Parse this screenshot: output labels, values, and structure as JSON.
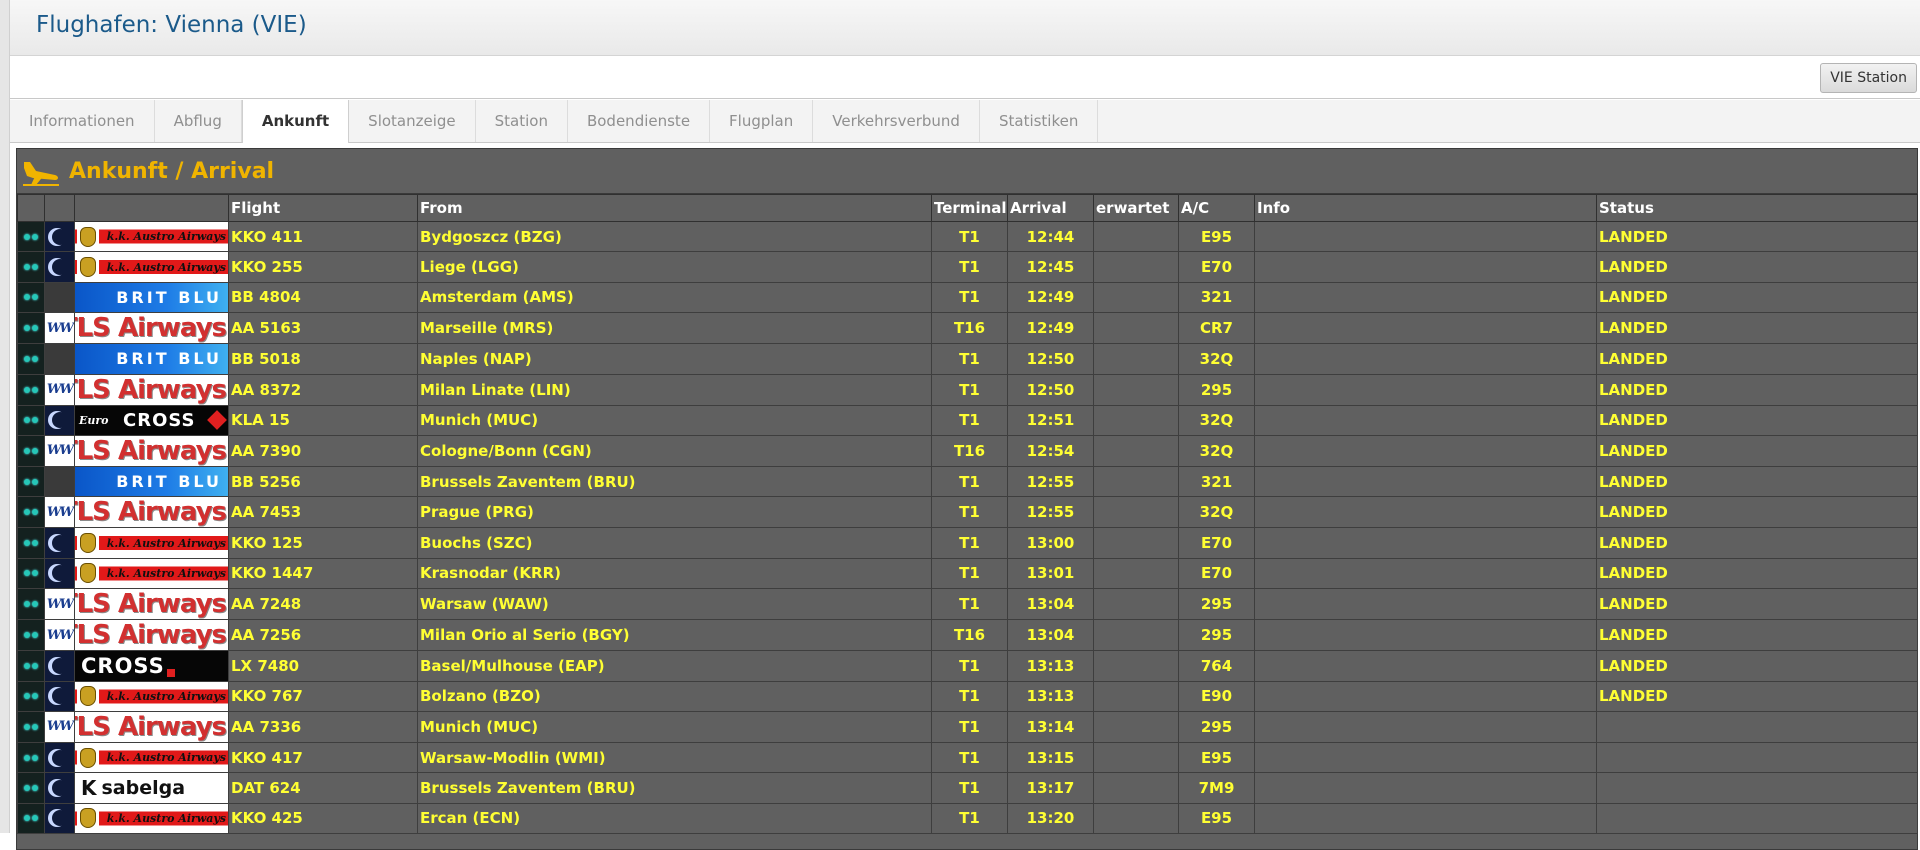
{
  "header": {
    "title": "Flughafen: Vienna (VIE)",
    "station_button": "VIE Station"
  },
  "tabs": [
    {
      "label": "Informationen",
      "active": false
    },
    {
      "label": "Abflug",
      "active": false
    },
    {
      "label": "Ankunft",
      "active": true
    },
    {
      "label": "Slotanzeige",
      "active": false
    },
    {
      "label": "Station",
      "active": false
    },
    {
      "label": "Bodendienste",
      "active": false
    },
    {
      "label": "Flugplan",
      "active": false
    },
    {
      "label": "Verkehrsverbund",
      "active": false
    },
    {
      "label": "Statistiken",
      "active": false
    }
  ],
  "board": {
    "title": "Ankunft / Arrival",
    "accent_color": "#f0b400",
    "value_color": "#ffff33",
    "columns": {
      "flight": "Flight",
      "from": "From",
      "terminal": "Terminal",
      "arrival": "Arrival",
      "expected": "erwartet",
      "ac": "A/C",
      "info": "Info",
      "status": "Status"
    },
    "logos": {
      "kk": {
        "text": "k.k. Austro Airways"
      },
      "brit": {
        "text": "BRIT BLU"
      },
      "tls": {
        "text": "TLS Airways",
        "badge": "WW"
      },
      "euro": {
        "text": "CROSS",
        "prefix": "Euro"
      },
      "cross": {
        "text": "CROSS"
      },
      "sabelga": {
        "text": "sabelga",
        "mark": "K"
      }
    },
    "rows": [
      {
        "logo": "kk",
        "flight": "KKO 411",
        "from": "Bydgoszcz (BZG)",
        "terminal": "T1",
        "arrival": "12:44",
        "expected": "",
        "ac": "E95",
        "info": "",
        "status": "LANDED"
      },
      {
        "logo": "kk",
        "flight": "KKO 255",
        "from": "Liege (LGG)",
        "terminal": "T1",
        "arrival": "12:45",
        "expected": "",
        "ac": "E70",
        "info": "",
        "status": "LANDED"
      },
      {
        "logo": "brit",
        "flight": "BB 4804",
        "from": "Amsterdam (AMS)",
        "terminal": "T1",
        "arrival": "12:49",
        "expected": "",
        "ac": "321",
        "info": "",
        "status": "LANDED"
      },
      {
        "logo": "tls",
        "flight": "AA 5163",
        "from": "Marseille (MRS)",
        "terminal": "T16",
        "arrival": "12:49",
        "expected": "",
        "ac": "CR7",
        "info": "",
        "status": "LANDED"
      },
      {
        "logo": "brit",
        "flight": "BB 5018",
        "from": "Naples (NAP)",
        "terminal": "T1",
        "arrival": "12:50",
        "expected": "",
        "ac": "32Q",
        "info": "",
        "status": "LANDED"
      },
      {
        "logo": "tls",
        "flight": "AA 8372",
        "from": "Milan Linate (LIN)",
        "terminal": "T1",
        "arrival": "12:50",
        "expected": "",
        "ac": "295",
        "info": "",
        "status": "LANDED"
      },
      {
        "logo": "euro",
        "flight": "KLA 15",
        "from": "Munich (MUC)",
        "terminal": "T1",
        "arrival": "12:51",
        "expected": "",
        "ac": "32Q",
        "info": "",
        "status": "LANDED"
      },
      {
        "logo": "tls",
        "flight": "AA 7390",
        "from": "Cologne/Bonn (CGN)",
        "terminal": "T16",
        "arrival": "12:54",
        "expected": "",
        "ac": "32Q",
        "info": "",
        "status": "LANDED"
      },
      {
        "logo": "brit",
        "flight": "BB 5256",
        "from": "Brussels Zaventem (BRU)",
        "terminal": "T1",
        "arrival": "12:55",
        "expected": "",
        "ac": "321",
        "info": "",
        "status": "LANDED"
      },
      {
        "logo": "tls",
        "flight": "AA 7453",
        "from": "Prague (PRG)",
        "terminal": "T1",
        "arrival": "12:55",
        "expected": "",
        "ac": "32Q",
        "info": "",
        "status": "LANDED"
      },
      {
        "logo": "kk",
        "flight": "KKO 125",
        "from": "Buochs (SZC)",
        "terminal": "T1",
        "arrival": "13:00",
        "expected": "",
        "ac": "E70",
        "info": "",
        "status": "LANDED"
      },
      {
        "logo": "kk",
        "flight": "KKO 1447",
        "from": "Krasnodar (KRR)",
        "terminal": "T1",
        "arrival": "13:01",
        "expected": "",
        "ac": "E70",
        "info": "",
        "status": "LANDED"
      },
      {
        "logo": "tls",
        "flight": "AA 7248",
        "from": "Warsaw (WAW)",
        "terminal": "T1",
        "arrival": "13:04",
        "expected": "",
        "ac": "295",
        "info": "",
        "status": "LANDED"
      },
      {
        "logo": "tls",
        "flight": "AA 7256",
        "from": "Milan Orio al Serio (BGY)",
        "terminal": "T16",
        "arrival": "13:04",
        "expected": "",
        "ac": "295",
        "info": "",
        "status": "LANDED"
      },
      {
        "logo": "cross",
        "flight": "LX 7480",
        "from": "Basel/Mulhouse (EAP)",
        "terminal": "T1",
        "arrival": "13:13",
        "expected": "",
        "ac": "764",
        "info": "",
        "status": "LANDED"
      },
      {
        "logo": "kk",
        "flight": "KKO 767",
        "from": "Bolzano (BZO)",
        "terminal": "T1",
        "arrival": "13:13",
        "expected": "",
        "ac": "E90",
        "info": "",
        "status": "LANDED"
      },
      {
        "logo": "tls",
        "flight": "AA 7336",
        "from": "Munich (MUC)",
        "terminal": "T1",
        "arrival": "13:14",
        "expected": "",
        "ac": "295",
        "info": "",
        "status": ""
      },
      {
        "logo": "kk",
        "flight": "KKO 417",
        "from": "Warsaw-Modlin (WMI)",
        "terminal": "T1",
        "arrival": "13:15",
        "expected": "",
        "ac": "E95",
        "info": "",
        "status": ""
      },
      {
        "logo": "sabelga",
        "flight": "DAT 624",
        "from": "Brussels Zaventem (BRU)",
        "terminal": "T1",
        "arrival": "13:17",
        "expected": "",
        "ac": "7M9",
        "info": "",
        "status": ""
      },
      {
        "logo": "kk",
        "flight": "KKO 425",
        "from": "Ercan (ECN)",
        "terminal": "T1",
        "arrival": "13:20",
        "expected": "",
        "ac": "E95",
        "info": "",
        "status": ""
      }
    ]
  }
}
